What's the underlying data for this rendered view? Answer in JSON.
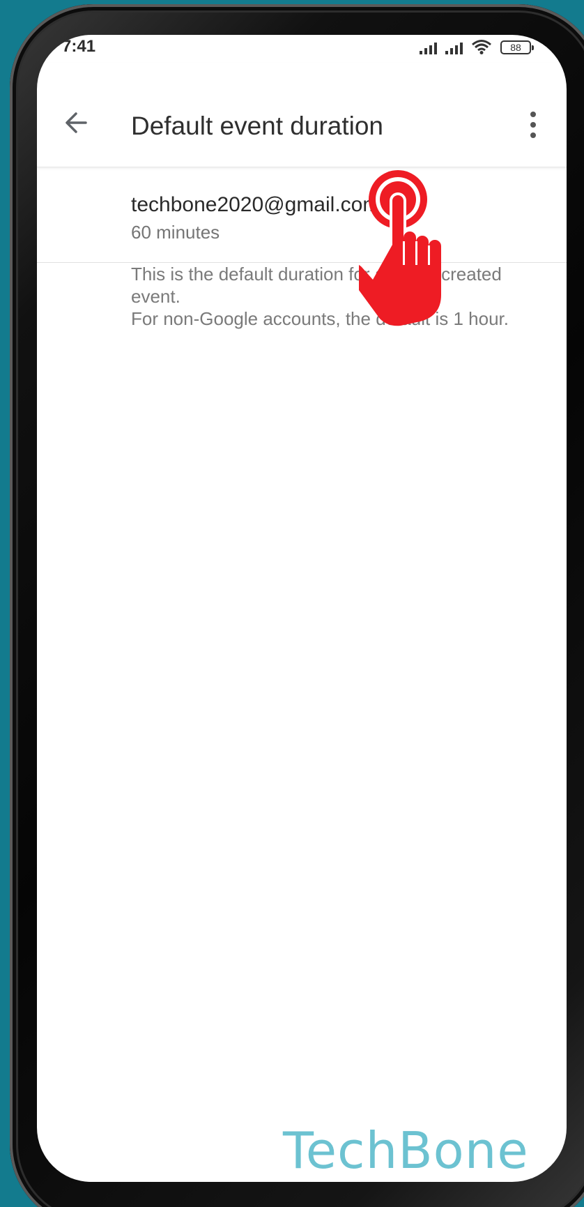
{
  "status_bar": {
    "time": "7:41",
    "battery": "88"
  },
  "app_bar": {
    "title": "Default event duration"
  },
  "account": {
    "email": "techbone2020@gmail.com",
    "duration": "60 minutes"
  },
  "description": {
    "line1": "This is the default duration for a newly created event.",
    "line2": "For non-Google accounts, the default is 1 hour."
  },
  "watermark": {
    "text": "TechBone"
  },
  "colors": {
    "background": "#137b8e",
    "tap_indicator": "#ee1c24",
    "watermark": "#6cc2d1"
  }
}
